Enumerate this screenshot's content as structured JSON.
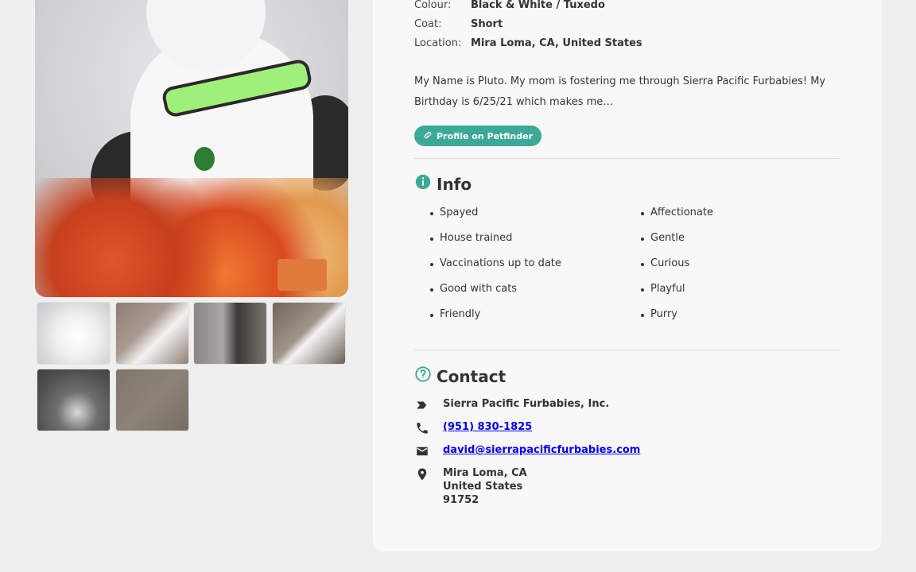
{
  "details": [
    {
      "label": "Colour:",
      "value": "Black & White / Tuxedo"
    },
    {
      "label": "Coat:",
      "value": "Short"
    },
    {
      "label": "Location:",
      "value": "Mira Loma, CA, United States"
    }
  ],
  "description": "My Name is Pluto. My mom is fostering me through Sierra Pacific Furbabies! My Birthday is 6/25/21 which makes me…",
  "petfinder_button": {
    "label": "Profile on Petfinder",
    "icon": "link-icon"
  },
  "info": {
    "title": "Info",
    "icon": "info-icon",
    "col1": [
      "Spayed",
      "House trained",
      "Vaccinations up to date",
      "Good with cats",
      "Friendly"
    ],
    "col2": [
      "Affectionate",
      "Gentle",
      "Curious",
      "Playful",
      "Purry"
    ]
  },
  "contact": {
    "title": "Contact",
    "icon": "question-circle-icon",
    "organization": "Sierra Pacific Furbabies, Inc.",
    "phone": "(951) 830-1825",
    "email": "david@sierrapacificfurbabies.com",
    "address_line1": "Mira Loma, CA",
    "address_line2": "United States",
    "address_line3": "91752"
  },
  "accent_color": "#3ba997"
}
